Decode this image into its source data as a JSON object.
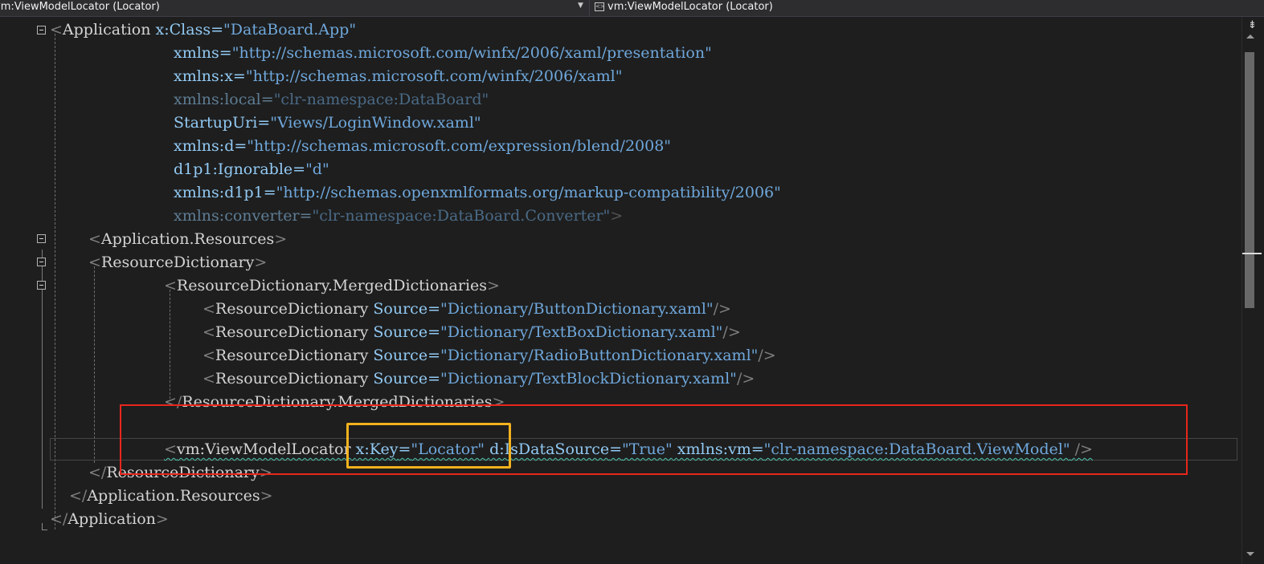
{
  "navbar": {
    "left_dropdown": "vm:ViewModelLocator (Locator)",
    "right_dropdown": "vm:ViewModelLocator (Locator)",
    "left_arrow_icon": "chevron-down-icon",
    "xaml_icon": "xaml-element-icon"
  },
  "code": {
    "l1": {
      "open": "<",
      "el": "Application",
      "a1": "x:Class",
      "eq": "=",
      "v1": "\"DataBoard.App\""
    },
    "l2": {
      "a": "xmlns",
      "eq": "=",
      "v": "\"http://schemas.microsoft.com/winfx/2006/xaml/presentation\""
    },
    "l3": {
      "a": "xmlns:x",
      "eq": "=",
      "v": "\"http://schemas.microsoft.com/winfx/2006/xaml\""
    },
    "l4": {
      "a": "xmlns:local",
      "eq": "=",
      "v": "\"clr-namespace:DataBoard\""
    },
    "l5": {
      "a": "StartupUri",
      "eq": "=",
      "v": "\"Views/LoginWindow.xaml\""
    },
    "l6": {
      "a": "xmlns:d",
      "eq": "=",
      "v": "\"http://schemas.microsoft.com/expression/blend/2008\""
    },
    "l7": {
      "a": "d1p1:Ignorable",
      "eq": "=",
      "v": "\"d\""
    },
    "l8": {
      "a": "xmlns:d1p1",
      "eq": "=",
      "v": "\"http://schemas.openxmlformats.org/markup-compatibility/2006\""
    },
    "l9": {
      "a": "xmlns:converter",
      "eq": "=",
      "v": "\"clr-namespace:DataBoard.Converter\"",
      "close": ">"
    },
    "l10": {
      "open": "<",
      "el": "Application.Resources",
      "close": ">"
    },
    "l11": {
      "open": "<",
      "el": "ResourceDictionary",
      "close": ">"
    },
    "l12": {
      "open": "<",
      "el": "ResourceDictionary.MergedDictionaries",
      "close": ">"
    },
    "l13": {
      "open": "<",
      "el": "ResourceDictionary",
      "a": "Source",
      "eq": "=",
      "v": "\"Dictionary/ButtonDictionary.xaml\"",
      "close": "/>"
    },
    "l14": {
      "open": "<",
      "el": "ResourceDictionary",
      "a": "Source",
      "eq": "=",
      "v": "\"Dictionary/TextBoxDictionary.xaml\"",
      "close": "/>"
    },
    "l15": {
      "open": "<",
      "el": "ResourceDictionary",
      "a": "Source",
      "eq": "=",
      "v": "\"Dictionary/RadioButtonDictionary.xaml\"",
      "close": "/>"
    },
    "l16": {
      "open": "<",
      "el": "ResourceDictionary",
      "a": "Source",
      "eq": "=",
      "v": "\"Dictionary/TextBlockDictionary.xaml\"",
      "close": "/>"
    },
    "l17": {
      "open": "</",
      "el": "ResourceDictionary.MergedDictionaries",
      "close": ">"
    },
    "l19": {
      "open": "<",
      "el": "vm:ViewModelLocator",
      "a1": "x:Key",
      "eq": "=",
      "v1": "\"Locator\"",
      "a2": "d:IsDataSource",
      "v2": "\"True\"",
      "a3": "xmlns:vm",
      "v3": "\"clr-namespace:DataBoard.ViewModel\"",
      "close": "/>"
    },
    "l20": {
      "open": "</",
      "el": "ResourceDictionary",
      "close": ">"
    },
    "l21": {
      "open": "</",
      "el": "Application.Resources",
      "close": ">"
    },
    "l22": {
      "open": "</",
      "el": "Application",
      "close": ">"
    }
  },
  "colors": {
    "background": "#1e1e1e",
    "element": "#d4d4d4",
    "attribute": "#92caf4",
    "string": "#6fa8dc",
    "bracket": "#808080",
    "highlight_red": "#e8261c",
    "highlight_yellow": "#f3b21d"
  },
  "scrollbar": {
    "split_icon": "split-window-icon"
  }
}
